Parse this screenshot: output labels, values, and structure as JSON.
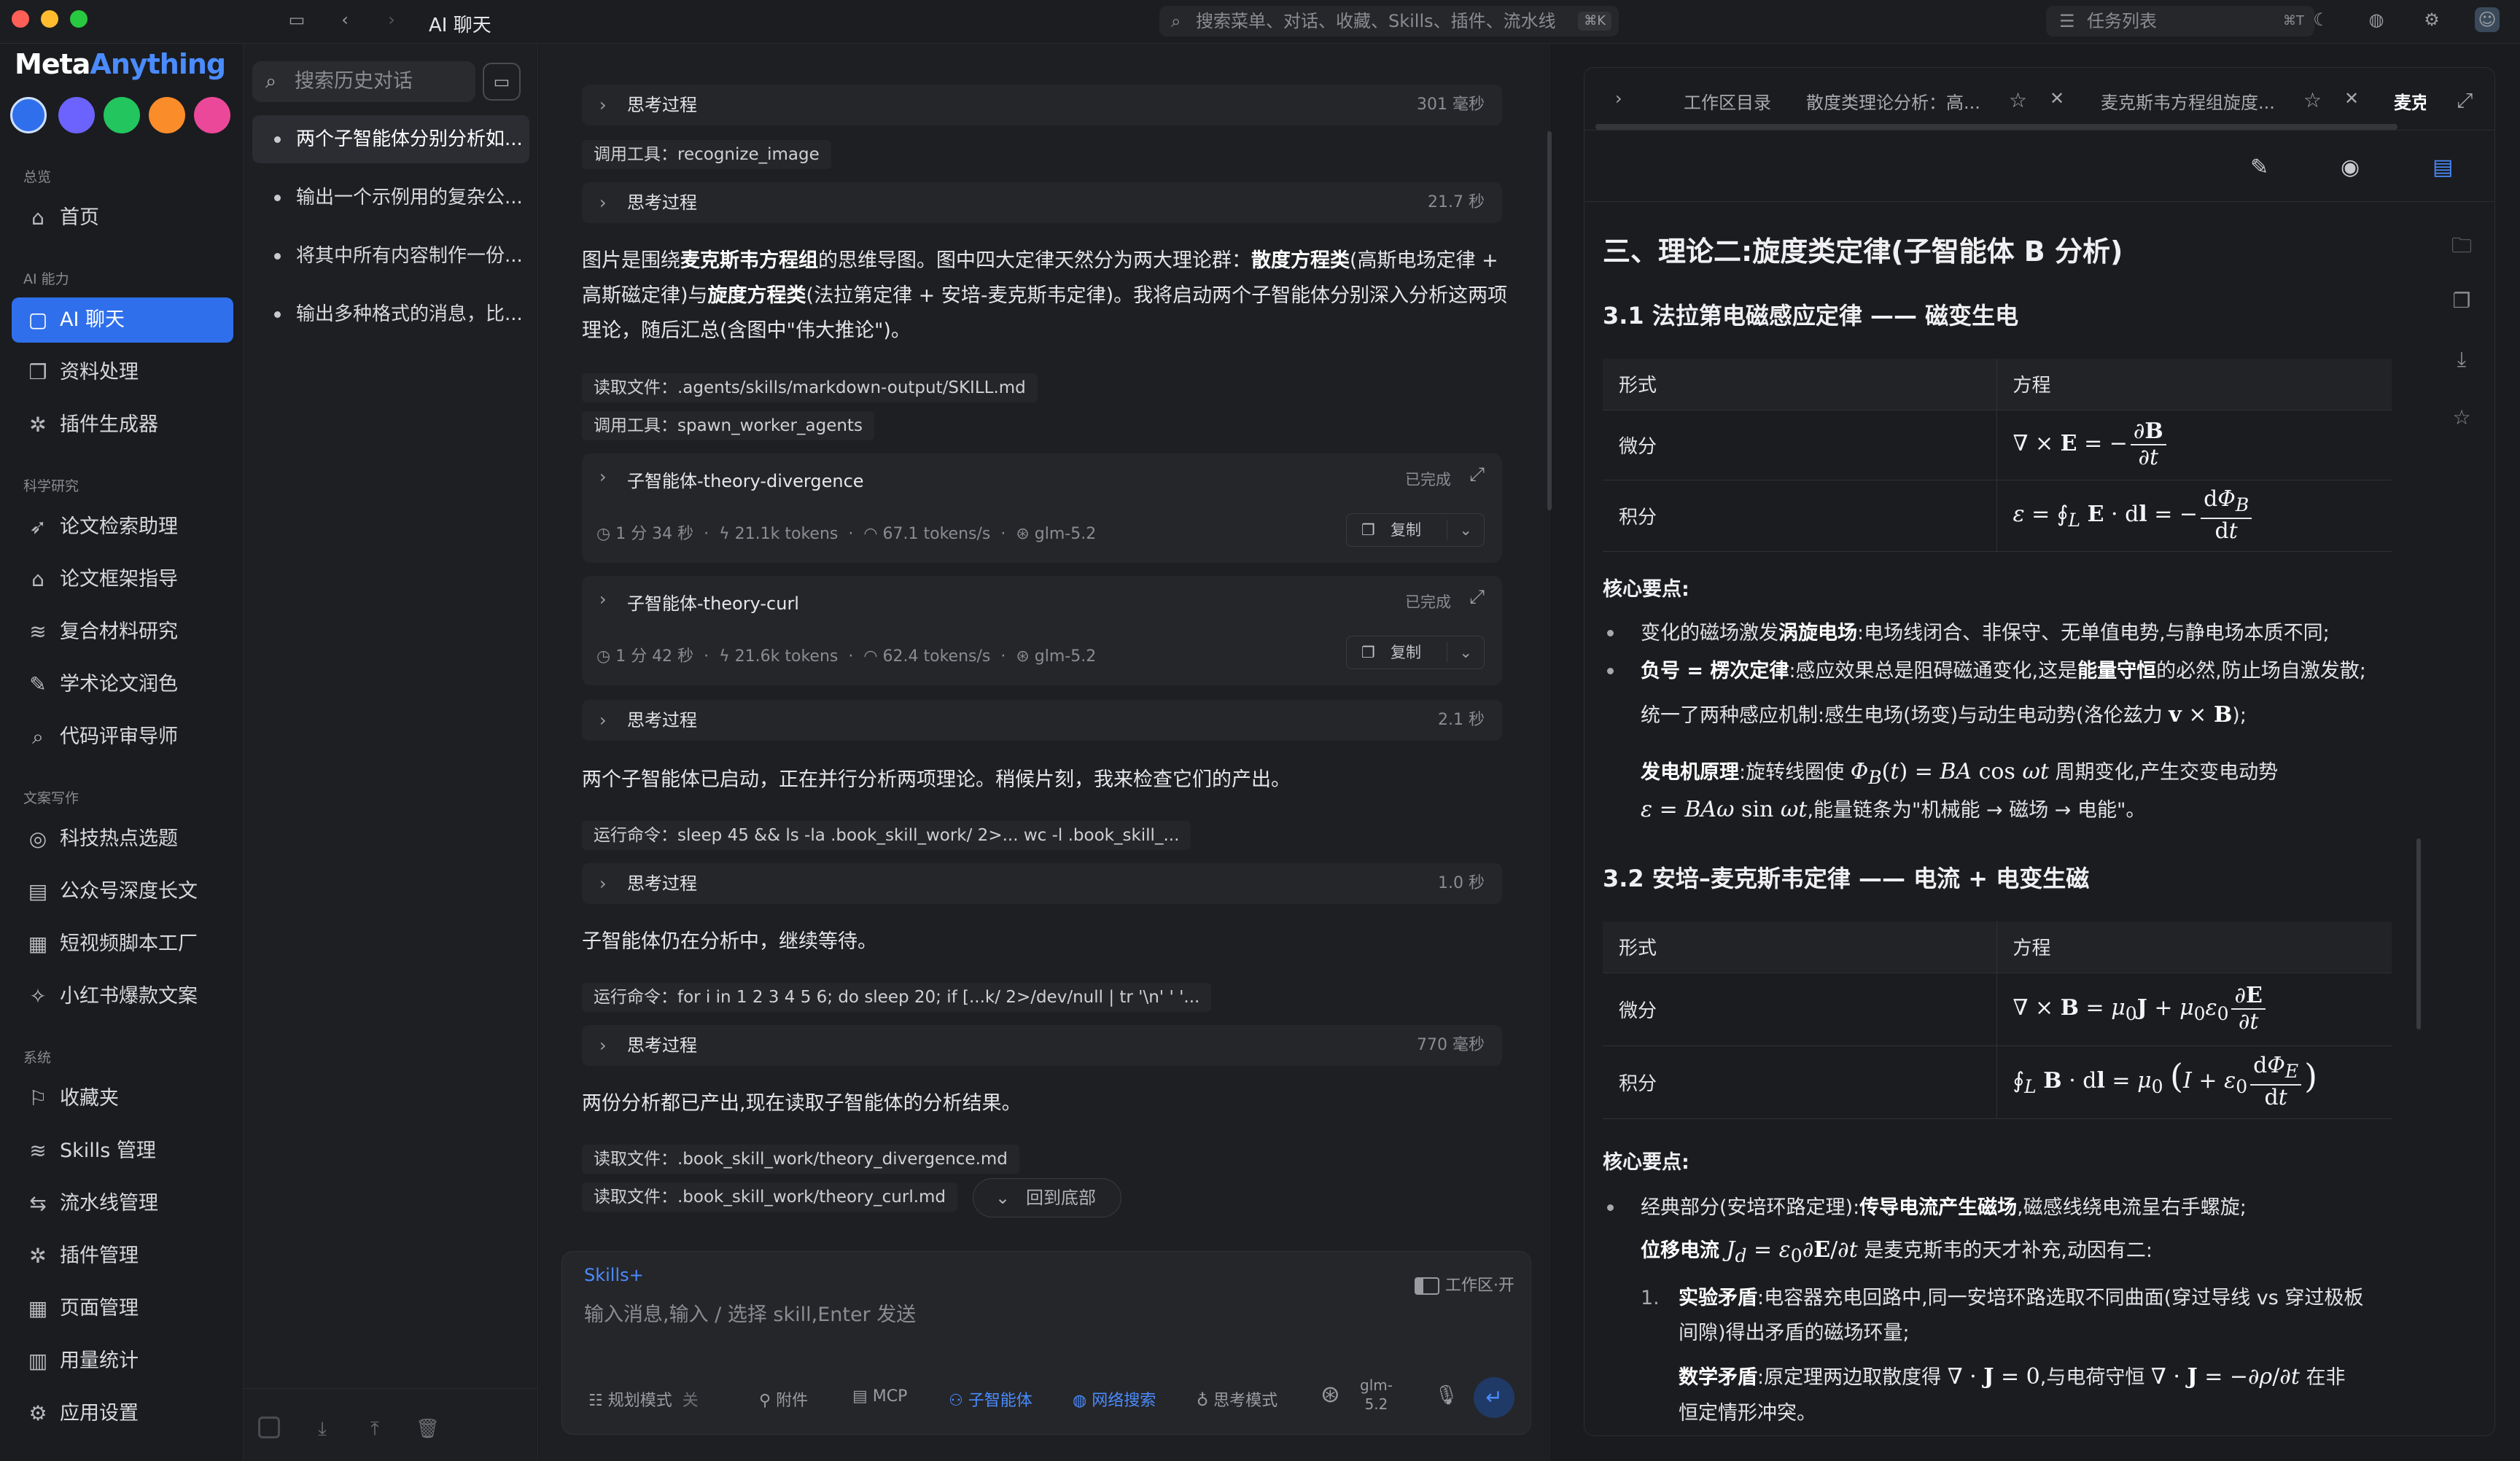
{
  "window": {
    "title": "AI 聊天",
    "search_placeholder": "搜索菜单、对话、收藏、Skills、插件、流水线",
    "search_shortcut": "⌘K",
    "task_list_label": "任务列表",
    "task_list_shortcut": "⌘T"
  },
  "brand": {
    "name_part1": "Meta",
    "name_part2": "Anything",
    "accent_color": "#4a8cff",
    "theme_colors": [
      "#2f6feb",
      "#6c63ff",
      "#22c55e",
      "#fb8c2a",
      "#ec4899"
    ]
  },
  "sidebar": {
    "sections": [
      {
        "title": "总览",
        "items": [
          {
            "label": "首页",
            "icon": "home-icon"
          }
        ]
      },
      {
        "title": "AI 能力",
        "items": [
          {
            "label": "AI 聊天",
            "icon": "chat-icon",
            "active": true
          },
          {
            "label": "资料处理",
            "icon": "book-icon"
          },
          {
            "label": "插件生成器",
            "icon": "puzzle-icon"
          }
        ]
      },
      {
        "title": "科学研究",
        "items": [
          {
            "label": "论文检索助理",
            "icon": "rocket-icon"
          },
          {
            "label": "论文框架指导",
            "icon": "graduation-icon"
          },
          {
            "label": "复合材料研究",
            "icon": "layers-icon"
          },
          {
            "label": "学术论文润色",
            "icon": "pen-icon"
          },
          {
            "label": "代码评审导师",
            "icon": "magnify-icon"
          }
        ]
      },
      {
        "title": "文案写作",
        "items": [
          {
            "label": "科技热点选题",
            "icon": "target-icon"
          },
          {
            "label": "公众号深度长文",
            "icon": "article-icon"
          },
          {
            "label": "短视频脚本工厂",
            "icon": "clapper-icon"
          },
          {
            "label": "小红书爆款文案",
            "icon": "sparkle-icon"
          }
        ]
      },
      {
        "title": "系统",
        "items": [
          {
            "label": "收藏夹",
            "icon": "bookmark-icon"
          },
          {
            "label": "Skills 管理",
            "icon": "stack-icon"
          },
          {
            "label": "流水线管理",
            "icon": "pipeline-icon"
          },
          {
            "label": "插件管理",
            "icon": "plugin-icon"
          },
          {
            "label": "页面管理",
            "icon": "grid-icon"
          },
          {
            "label": "用量统计",
            "icon": "chart-icon"
          },
          {
            "label": "应用设置",
            "icon": "gear-icon"
          }
        ]
      }
    ]
  },
  "history": {
    "search_placeholder": "搜索历史对话",
    "items": [
      {
        "label": "两个子智能体分别分析如...",
        "active": true
      },
      {
        "label": "输出一个示例用的复杂公..."
      },
      {
        "label": "将其中所有内容制作一份..."
      },
      {
        "label": "输出多种格式的消息，比..."
      }
    ]
  },
  "chat": {
    "think_label": "思考过程",
    "think1_ms": "301 毫秒",
    "tool1": "调用工具：recognize_image",
    "think2_ms": "21.7 秒",
    "para1_a": "图片是围绕",
    "para1_b": "麦克斯韦方程组",
    "para1_c": "的思维导图。图中四大定律天然分为两大理论群：",
    "para1_d": "散度方程类",
    "para1_e": "(高斯电场定律 + 高斯磁定律)与",
    "para1_f": "旋度方程类",
    "para1_g": "(法拉第定律 + 安培-麦克斯韦定律)。我将启动两个子智能体分别深入分析这两项理论，随后汇总(含图中\"伟大推论\")。",
    "tool2": "读取文件：.agents/skills/markdown-output/SKILL.md",
    "tool3": "调用工具：spawn_worker_agents",
    "agents": [
      {
        "name": "子智能体-theory-divergence",
        "status": "已完成",
        "time": "1 分 34 秒",
        "tokens": "21.1k tokens",
        "speed": "67.1 tokens/s",
        "model": "glm-5.2",
        "copy": "复制"
      },
      {
        "name": "子智能体-theory-curl",
        "status": "已完成",
        "time": "1 分 42 秒",
        "tokens": "21.6k tokens",
        "speed": "62.4 tokens/s",
        "model": "glm-5.2",
        "copy": "复制"
      }
    ],
    "think3_ms": "2.1 秒",
    "para2": "两个子智能体已启动，正在并行分析两项理论。稍候片刻，我来检查它们的产出。",
    "tool4": "运行命令：sleep 45 && ls -la .book_skill_work/ 2>... wc -l .book_skill_...",
    "think4_ms": "1.0 秒",
    "para3": "子智能体仍在分析中，继续等待。",
    "tool5": "运行命令：for i in 1 2 3 4 5 6; do sleep 20; if [...k/ 2>/dev/null | tr '\\n' ' '...",
    "think5_ms": "770 毫秒",
    "para4": "两份分析都已产出,现在读取子智能体的分析结果。",
    "tool6": "读取文件：.book_skill_work/theory_divergence.md",
    "tool7": "读取文件：.book_skill_work/theory_curl.md",
    "to_bottom": "回到底部"
  },
  "input": {
    "skills_label": "Skills+",
    "workspace_toggle": "工作区·开",
    "placeholder": "输入消息,输入 / 选择 skill,Enter 发送",
    "plan_mode": "规划模式",
    "plan_state": "关",
    "attach": "附件",
    "mcp": "MCP",
    "subagent": "子智能体",
    "web_search": "网络搜索",
    "think_mode": "思考模式",
    "model_line1": "glm-",
    "model_line2": "5.2"
  },
  "doc": {
    "tabs": [
      "工作区目录",
      "散度类理论分析：高...",
      "麦克斯韦方程组旋度...",
      "麦克"
    ],
    "section_title": "三、理论二:旋度类定律(子智能体 B 分析)",
    "s31_title": "3.1 法拉第电磁感应定律 —— 磁变生电",
    "col_form": "形式",
    "col_eq": "方程",
    "row_diff": "微分",
    "row_int": "积分",
    "key_points": "核心要点:",
    "f_b1_a": "变化的磁场激发",
    "f_b1_b": "涡旋电场",
    "f_b1_c": ":电场线闭合、非保守、无单值电势,与静电场本质不同;",
    "f_b2_a": "负号 = 楞次定律",
    "f_b2_b": ":感应效果总是阻碍磁通变化,这是",
    "f_b2_c": "能量守恒",
    "f_b2_d": "的必然,防止场自激发散;",
    "f_b3": "统一了两种感应机制:感生电场(场变)与动生电动势(洛伦兹力 ",
    "f_b3_end": ");",
    "f_gen_a": "发电机原理",
    "f_gen_b": ":旋转线圈使 ",
    "f_gen_c": " 周期变化,产生交变电动势",
    "f_gen_d": ",能量链条为\"机械能 → 磁场 → 电能\"。",
    "s32_title": "3.2 安培–麦克斯韦定律 —— 电流 + 电变生磁",
    "a_b1_a": "经典部分(安培环路定理):",
    "a_b1_b": "传导电流产生磁场",
    "a_b1_c": ",磁感线绕电流呈右手螺旋;",
    "a_b2_a": "位移电流 ",
    "a_b2_b": " 是麦克斯韦的天才补充,动因有二:",
    "a_n1_a": "实验矛盾",
    "a_n1_b": ":电容器充电回路中,同一安培环路选取不同曲面(穿过导线 vs 穿过极板",
    "a_n1_c": "间隙)得出矛盾的磁场环量;",
    "a_n2_a": "数学矛盾",
    "a_n2_b": ":原定理两边取散度得 ",
    "a_n2_c": ",与电荷守恒 ",
    "a_n2_d": " 在非",
    "a_n2_e": "恒定情形冲突。"
  }
}
